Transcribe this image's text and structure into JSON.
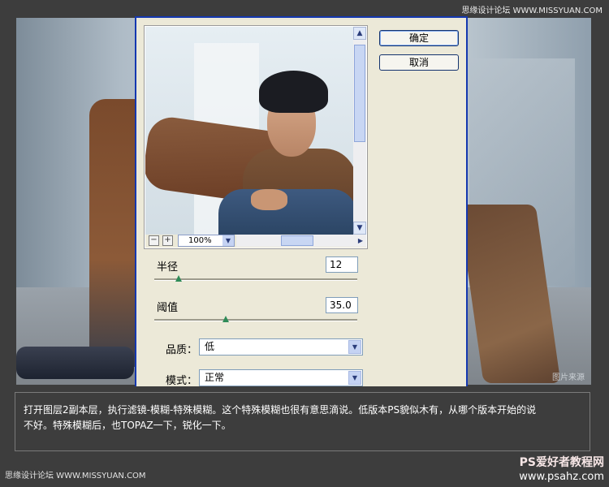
{
  "credits": {
    "top_right": "思缘设计论坛 WWW.MISSYUAN.COM",
    "bottom_left": "思缘设计论坛 WWW.MISSYUAN.COM",
    "brand_title": "PS爱好者教程网",
    "brand_url": "www.psahz.com",
    "photo_watermark": "图片来源"
  },
  "dialog": {
    "ok_label": "确定",
    "cancel_label": "取消",
    "zoom_level": "100%",
    "zoom_minus": "−",
    "zoom_plus": "+",
    "radius": {
      "label": "半径",
      "value": "12",
      "slider_fraction": 0.12
    },
    "threshold": {
      "label": "阈值",
      "value": "35.0",
      "slider_fraction": 0.35
    },
    "quality": {
      "label": "品质：",
      "value": "低"
    },
    "mode": {
      "label": "模式：",
      "value": "正常"
    }
  },
  "caption": {
    "line1": "打开图层2副本层，执行滤镜-模糊-特殊模糊。这个特殊模糊也很有意思滴说。低版本PS貌似木有，从哪个版本开始的说",
    "line2": "不好。特殊模糊后，也TOPAZ一下，锐化一下。"
  },
  "colors": {
    "dialog_border": "#1438b0",
    "dialog_bg": "#ece9d8",
    "page_bg": "#3d3d3d"
  }
}
